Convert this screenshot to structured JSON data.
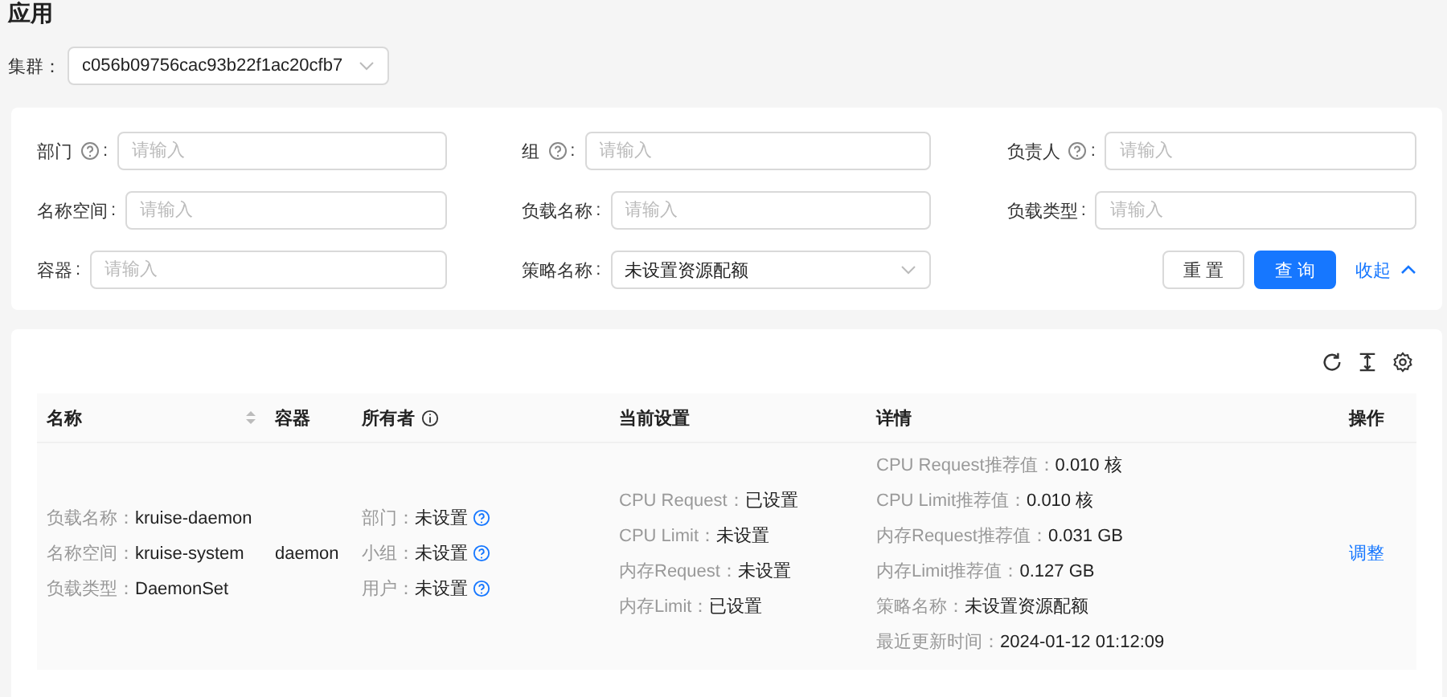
{
  "page_title": "应用",
  "cluster": {
    "label": "集群：",
    "value": "c056b09756cac93b22f1ac20cfb7"
  },
  "filters": [
    {
      "label": "部门",
      "help": true,
      "colon": ":",
      "kind": "input",
      "placeholder": "请输入"
    },
    {
      "label": "组",
      "help": true,
      "colon": ":",
      "kind": "input",
      "placeholder": "请输入"
    },
    {
      "label": "负责人",
      "help": true,
      "colon": ":",
      "kind": "input",
      "placeholder": "请输入"
    },
    {
      "label": "名称空间",
      "help": false,
      "colon": ":",
      "kind": "input",
      "placeholder": "请输入"
    },
    {
      "label": "负载名称",
      "help": false,
      "colon": ":",
      "kind": "input",
      "placeholder": "请输入"
    },
    {
      "label": "负载类型",
      "help": false,
      "colon": ":",
      "kind": "input",
      "placeholder": "请输入"
    },
    {
      "label": "容器",
      "help": false,
      "colon": ":",
      "kind": "input",
      "placeholder": "请输入"
    },
    {
      "label": "策略名称",
      "help": false,
      "colon": ":",
      "kind": "select",
      "value": "未设置资源配额"
    }
  ],
  "filter_buttons": {
    "reset": "重 置",
    "query": "查 询",
    "collapse": "收起"
  },
  "table": {
    "columns": [
      {
        "label": "名称",
        "sortable": true,
        "info": false
      },
      {
        "label": "容器",
        "sortable": false,
        "info": false
      },
      {
        "label": "所有者",
        "sortable": false,
        "info": true
      },
      {
        "label": "当前设置",
        "sortable": false,
        "info": false
      },
      {
        "label": "详情",
        "sortable": false,
        "info": false
      },
      {
        "label": "操作",
        "sortable": false,
        "info": false
      }
    ],
    "rows": [
      {
        "name": [
          {
            "label": "负载名称：",
            "value": "kruise-daemon"
          },
          {
            "label": "名称空间：",
            "value": "kruise-system"
          },
          {
            "label": "负载类型：",
            "value": "DaemonSet"
          }
        ],
        "container": "daemon",
        "owner": [
          {
            "label": "部门：",
            "value": "未设置",
            "help": true
          },
          {
            "label": "小组：",
            "value": "未设置",
            "help": true
          },
          {
            "label": "用户：",
            "value": "未设置",
            "help": true
          }
        ],
        "current": [
          {
            "label": "CPU Request：",
            "value": "已设置"
          },
          {
            "label": "CPU Limit：",
            "value": "未设置"
          },
          {
            "label": "内存Request：",
            "value": "未设置"
          },
          {
            "label": "内存Limit：",
            "value": "已设置"
          }
        ],
        "details": [
          {
            "label": "CPU Request推荐值：",
            "value": "0.010 核"
          },
          {
            "label": "CPU Limit推荐值：",
            "value": "0.010 核"
          },
          {
            "label": "内存Request推荐值：",
            "value": "0.031 GB"
          },
          {
            "label": "内存Limit推荐值：",
            "value": "0.127 GB"
          },
          {
            "label": "策略名称：",
            "value": "未设置资源配额"
          },
          {
            "label": "最近更新时间：",
            "value": "2024-01-12 01:12:09"
          }
        ],
        "action": "调整"
      }
    ]
  }
}
